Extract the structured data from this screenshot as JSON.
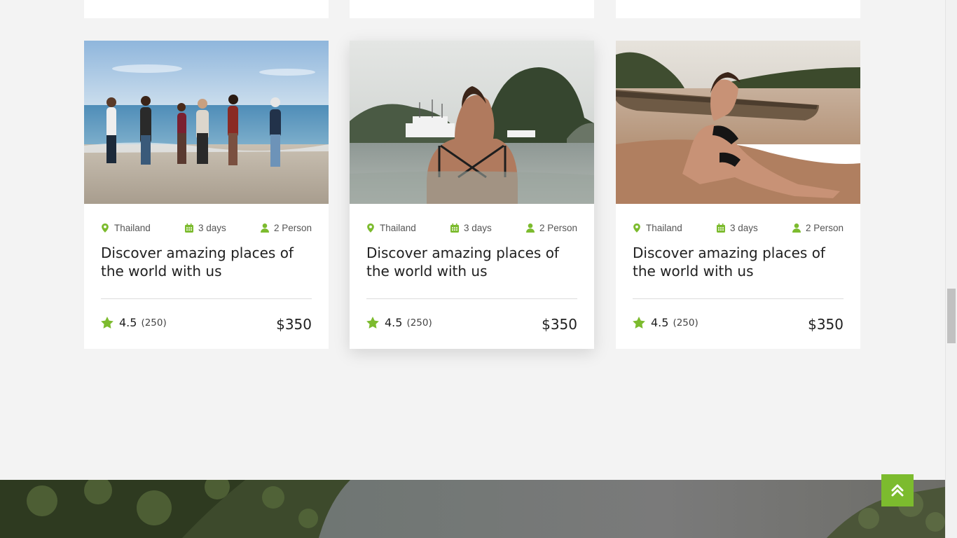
{
  "colors": {
    "accent": "#7cbb2e",
    "page_background": "#f3f3f3",
    "card_background": "#ffffff",
    "text": "#1f1f1f"
  },
  "tours": [
    {
      "location": "Thailand",
      "duration": "3 days",
      "people": "2 Person",
      "title": "Discover amazing places of the world with us",
      "rating": "4.5",
      "reviews": "(250)",
      "price": "$350"
    },
    {
      "location": "Thailand",
      "duration": "3 days",
      "people": "2 Person",
      "title": "Discover amazing places of the world with us",
      "rating": "4.5",
      "reviews": "(250)",
      "price": "$350"
    },
    {
      "location": "Thailand",
      "duration": "3 days",
      "people": "2 Person",
      "title": "Discover amazing places of the world with us",
      "rating": "4.5",
      "reviews": "(250)",
      "price": "$350"
    }
  ],
  "icons": {
    "location": "map-pin-icon",
    "duration": "calendar-icon",
    "people": "user-icon",
    "rating": "star-icon",
    "back_to_top": "double-chevron-up-icon"
  }
}
